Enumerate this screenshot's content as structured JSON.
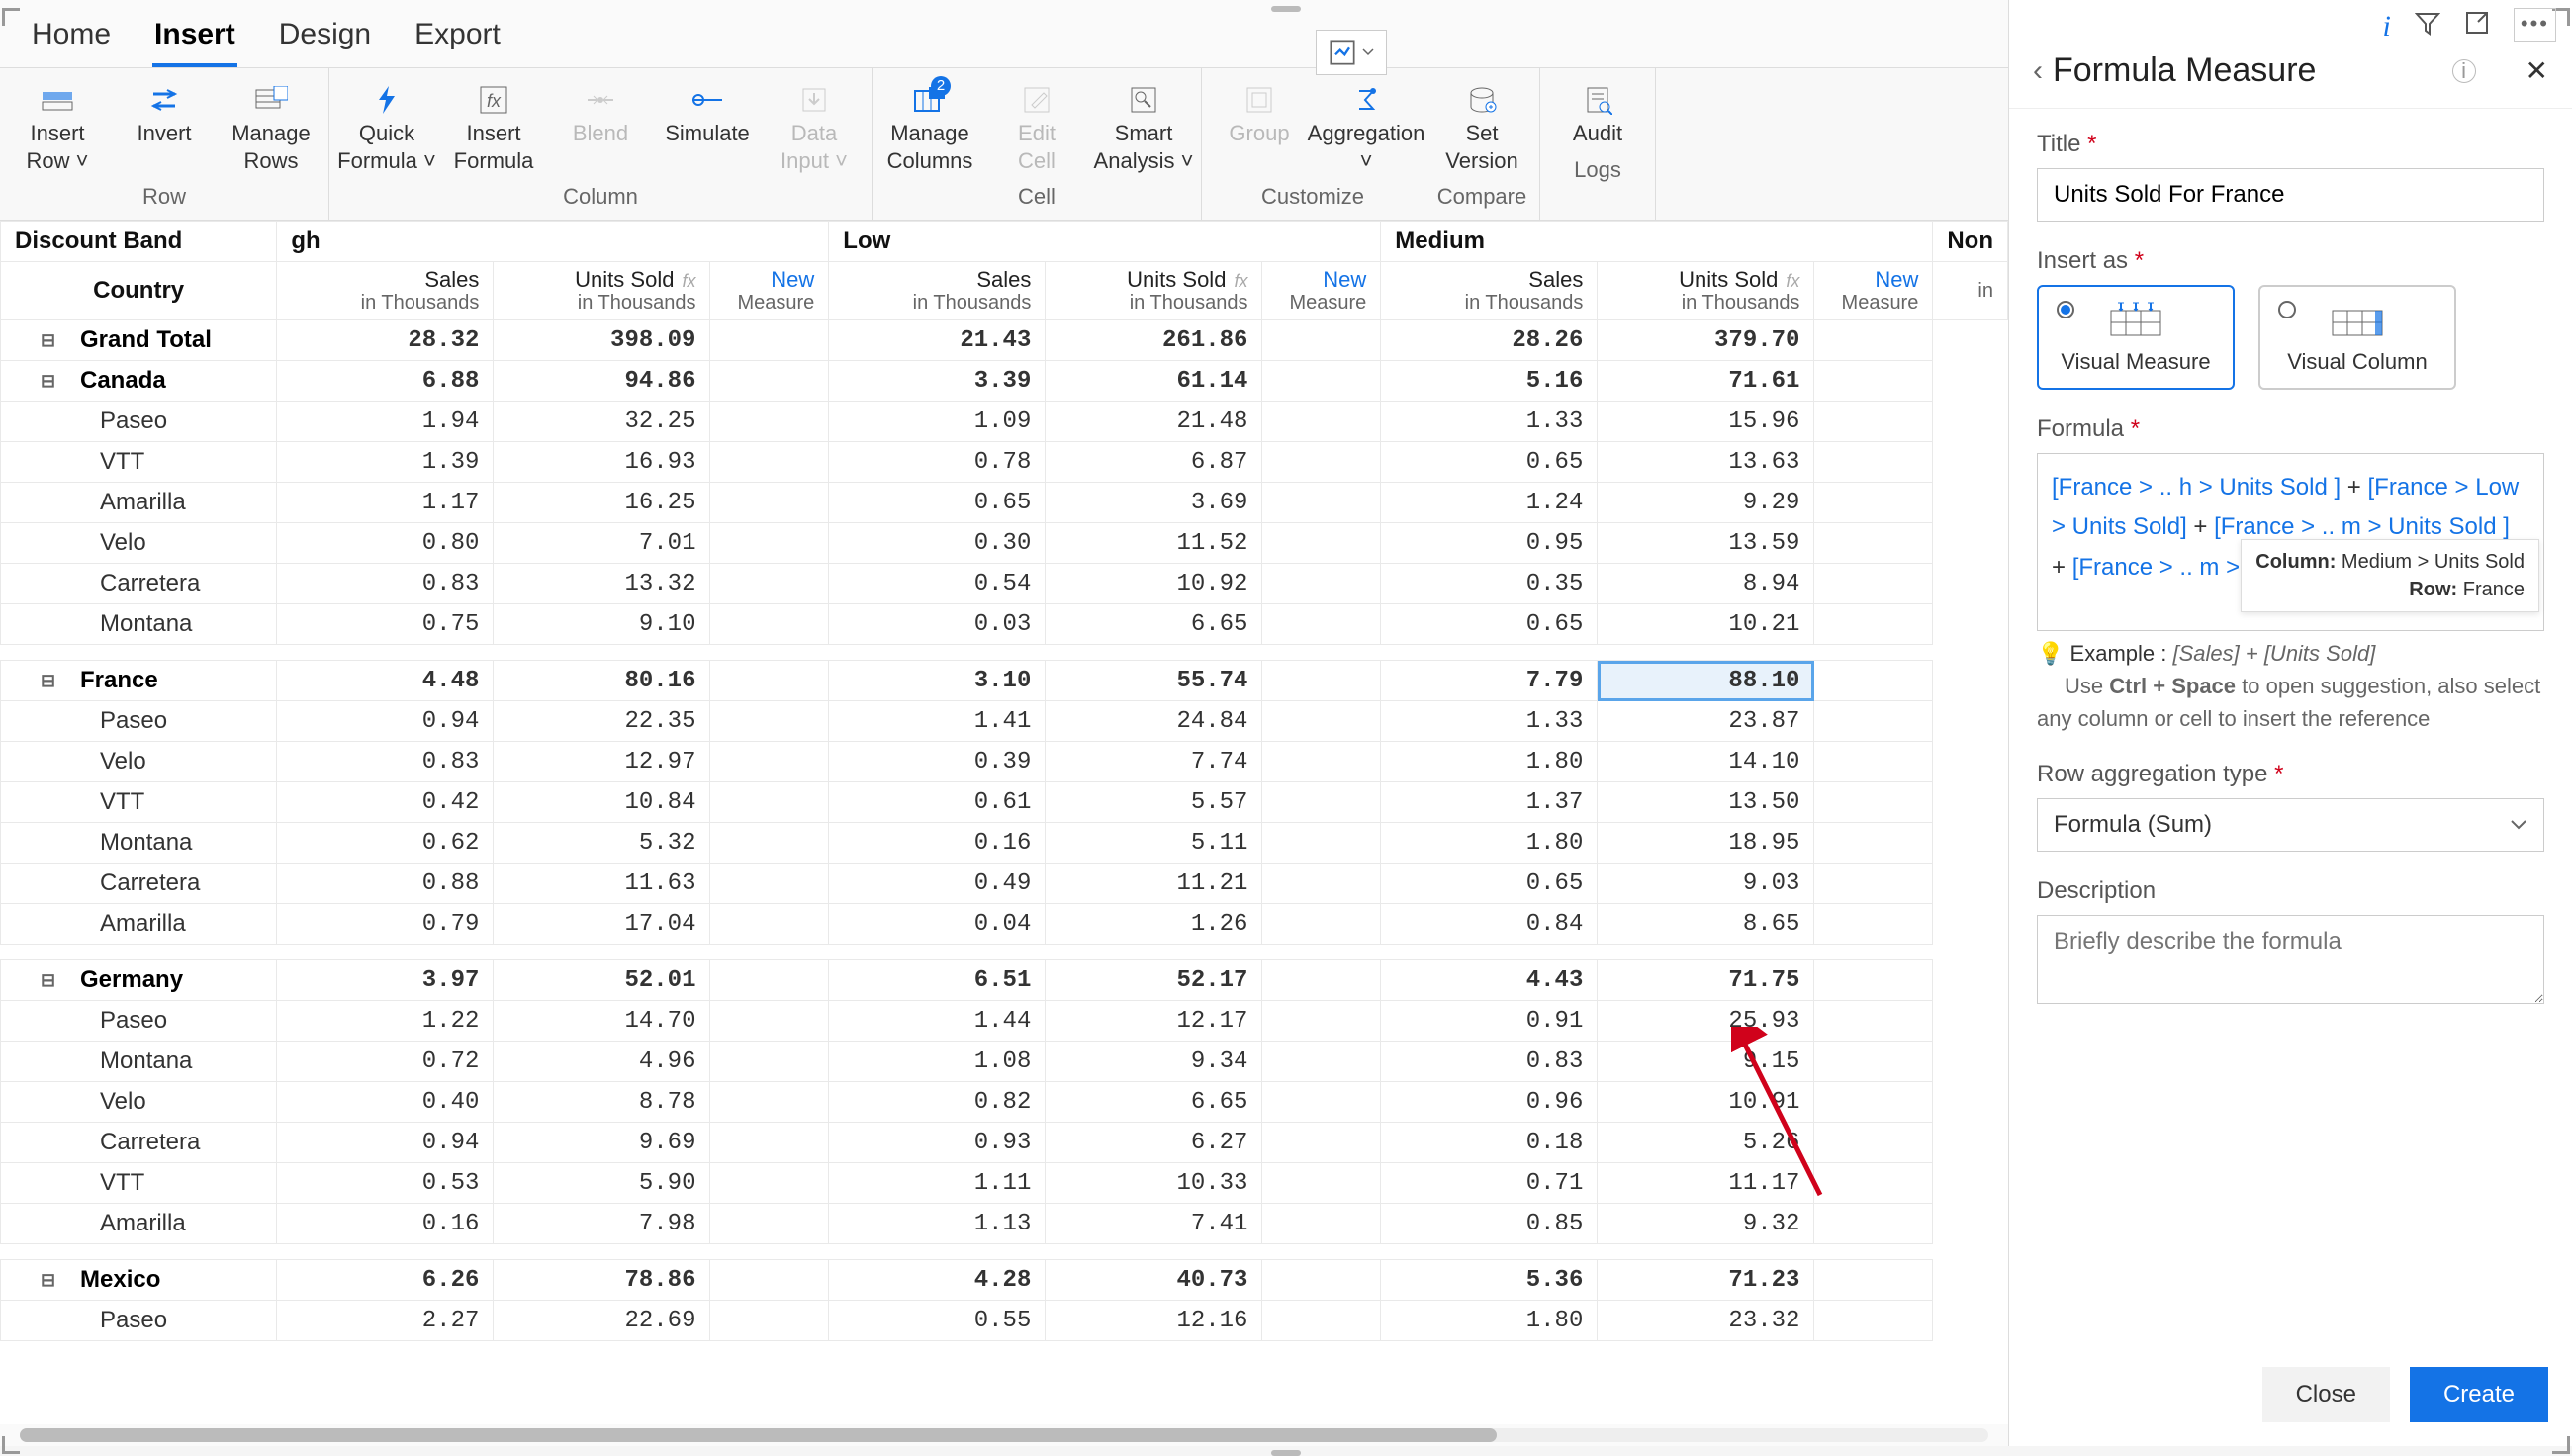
{
  "tabs": [
    "Home",
    "Insert",
    "Design",
    "Export"
  ],
  "active_tab": "Insert",
  "ribbon": [
    {
      "label": "Row",
      "buttons": [
        {
          "l1": "Insert",
          "l2": "Row ˅",
          "icon": "row-insert"
        },
        {
          "l1": "Invert",
          "l2": "",
          "icon": "invert"
        },
        {
          "l1": "Manage",
          "l2": "Rows",
          "icon": "rows"
        }
      ]
    },
    {
      "label": "Column",
      "buttons": [
        {
          "l1": "Quick",
          "l2": "Formula ˅",
          "icon": "bolt"
        },
        {
          "l1": "Insert",
          "l2": "Formula",
          "icon": "formula"
        },
        {
          "l1": "Blend",
          "l2": "",
          "icon": "blend",
          "disabled": true
        },
        {
          "l1": "Simulate",
          "l2": "",
          "icon": "simulate"
        },
        {
          "l1": "Data",
          "l2": "Input ˅",
          "icon": "data",
          "disabled": true
        }
      ]
    },
    {
      "label": "Cell",
      "buttons": [
        {
          "l1": "Manage",
          "l2": "Columns",
          "icon": "cols",
          "badge": "2"
        },
        {
          "l1": "Edit",
          "l2": "Cell",
          "icon": "edit",
          "disabled": true
        },
        {
          "l1": "Smart",
          "l2": "Analysis ˅",
          "icon": "smart"
        }
      ]
    },
    {
      "label": "Customize",
      "buttons": [
        {
          "l1": "Group",
          "l2": "",
          "icon": "group",
          "disabled": true
        },
        {
          "l1": "Aggregation",
          "l2": "˅",
          "icon": "agg"
        }
      ]
    },
    {
      "label": "Compare",
      "buttons": [
        {
          "l1": "Set",
          "l2": "Version",
          "icon": "version"
        }
      ]
    },
    {
      "label": "Logs",
      "buttons": [
        {
          "l1": "Audit",
          "l2": "",
          "icon": "audit"
        }
      ]
    }
  ],
  "table": {
    "corner": "Discount Band",
    "row_label": "Country",
    "bands": [
      "gh",
      "Low",
      "Medium",
      "Non"
    ],
    "measures": [
      {
        "name": "Sales",
        "sub": "in Thousands"
      },
      {
        "name": "Units Sold",
        "sub": "in Thousands",
        "fx": true
      },
      {
        "name": "New",
        "sub": "Measure",
        "new": true
      }
    ],
    "rows": [
      {
        "type": "grand",
        "label": "Grand Total",
        "v": [
          "28.32",
          "398.09",
          "",
          "21.43",
          "261.86",
          "",
          "28.26",
          "379.70",
          ""
        ]
      },
      {
        "type": "country",
        "label": "Canada",
        "v": [
          "6.88",
          "94.86",
          "",
          "3.39",
          "61.14",
          "",
          "5.16",
          "71.61",
          ""
        ]
      },
      {
        "type": "product",
        "label": "Paseo",
        "v": [
          "1.94",
          "32.25",
          "",
          "1.09",
          "21.48",
          "",
          "1.33",
          "15.96",
          ""
        ]
      },
      {
        "type": "product",
        "label": "VTT",
        "v": [
          "1.39",
          "16.93",
          "",
          "0.78",
          "6.87",
          "",
          "0.65",
          "13.63",
          ""
        ]
      },
      {
        "type": "product",
        "label": "Amarilla",
        "v": [
          "1.17",
          "16.25",
          "",
          "0.65",
          "3.69",
          "",
          "1.24",
          "9.29",
          ""
        ]
      },
      {
        "type": "product",
        "label": "Velo",
        "v": [
          "0.80",
          "7.01",
          "",
          "0.30",
          "11.52",
          "",
          "0.95",
          "13.59",
          ""
        ]
      },
      {
        "type": "product",
        "label": "Carretera",
        "v": [
          "0.83",
          "13.32",
          "",
          "0.54",
          "10.92",
          "",
          "0.35",
          "8.94",
          ""
        ]
      },
      {
        "type": "product",
        "label": "Montana",
        "v": [
          "0.75",
          "9.10",
          "",
          "0.03",
          "6.65",
          "",
          "0.65",
          "10.21",
          ""
        ]
      },
      {
        "type": "country",
        "label": "France",
        "v": [
          "4.48",
          "80.16",
          "",
          "3.10",
          "55.74",
          "",
          "7.79",
          "88.10",
          ""
        ],
        "sel": 7
      },
      {
        "type": "product",
        "label": "Paseo",
        "v": [
          "0.94",
          "22.35",
          "",
          "1.41",
          "24.84",
          "",
          "1.33",
          "23.87",
          ""
        ]
      },
      {
        "type": "product",
        "label": "Velo",
        "v": [
          "0.83",
          "12.97",
          "",
          "0.39",
          "7.74",
          "",
          "1.80",
          "14.10",
          ""
        ]
      },
      {
        "type": "product",
        "label": "VTT",
        "v": [
          "0.42",
          "10.84",
          "",
          "0.61",
          "5.57",
          "",
          "1.37",
          "13.50",
          ""
        ]
      },
      {
        "type": "product",
        "label": "Montana",
        "v": [
          "0.62",
          "5.32",
          "",
          "0.16",
          "5.11",
          "",
          "1.80",
          "18.95",
          ""
        ]
      },
      {
        "type": "product",
        "label": "Carretera",
        "v": [
          "0.88",
          "11.63",
          "",
          "0.49",
          "11.21",
          "",
          "0.65",
          "9.03",
          ""
        ]
      },
      {
        "type": "product",
        "label": "Amarilla",
        "v": [
          "0.79",
          "17.04",
          "",
          "0.04",
          "1.26",
          "",
          "0.84",
          "8.65",
          ""
        ]
      },
      {
        "type": "country",
        "label": "Germany",
        "v": [
          "3.97",
          "52.01",
          "",
          "6.51",
          "52.17",
          "",
          "4.43",
          "71.75",
          ""
        ]
      },
      {
        "type": "product",
        "label": "Paseo",
        "v": [
          "1.22",
          "14.70",
          "",
          "1.44",
          "12.17",
          "",
          "0.91",
          "25.93",
          ""
        ]
      },
      {
        "type": "product",
        "label": "Montana",
        "v": [
          "0.72",
          "4.96",
          "",
          "1.08",
          "9.34",
          "",
          "0.83",
          "9.15",
          ""
        ]
      },
      {
        "type": "product",
        "label": "Velo",
        "v": [
          "0.40",
          "8.78",
          "",
          "0.82",
          "6.65",
          "",
          "0.96",
          "10.91",
          ""
        ]
      },
      {
        "type": "product",
        "label": "Carretera",
        "v": [
          "0.94",
          "9.69",
          "",
          "0.93",
          "6.27",
          "",
          "0.18",
          "5.26",
          ""
        ]
      },
      {
        "type": "product",
        "label": "VTT",
        "v": [
          "0.53",
          "5.90",
          "",
          "1.11",
          "10.33",
          "",
          "0.71",
          "11.17",
          ""
        ]
      },
      {
        "type": "product",
        "label": "Amarilla",
        "v": [
          "0.16",
          "7.98",
          "",
          "1.13",
          "7.41",
          "",
          "0.85",
          "9.32",
          ""
        ]
      },
      {
        "type": "country",
        "label": "Mexico",
        "v": [
          "6.26",
          "78.86",
          "",
          "4.28",
          "40.73",
          "",
          "5.36",
          "71.23",
          ""
        ]
      },
      {
        "type": "product",
        "label": "Paseo",
        "v": [
          "2.27",
          "22.69",
          "",
          "0.55",
          "12.16",
          "",
          "1.80",
          "23.32",
          ""
        ]
      }
    ]
  },
  "panel": {
    "title": "Formula Measure",
    "title_field": {
      "label": "Title",
      "value": "Units Sold For France"
    },
    "insert_as": {
      "label": "Insert as",
      "options": [
        "Visual Measure",
        "Visual Column"
      ],
      "selected": 0
    },
    "formula": {
      "label": "Formula",
      "tokens": [
        "[France > .. h > Units Sold ]",
        "+",
        "[France > Low > Units Sold]",
        "+",
        "[France > .. m > Units Sold ]",
        "+",
        "[France > .. m > Units Sold ]"
      ],
      "tooltip": {
        "l1_k": "Column:",
        "l1_v": "Medium > Units Sold",
        "l2_k": "Row:",
        "l2_v": "France"
      }
    },
    "example": {
      "prefix": "Example :",
      "text": "[Sales] + [Units Sold]",
      "hint1": "Use ",
      "hint_key": "Ctrl + Space",
      "hint2": " to open suggestion, also select any column or cell to insert the reference"
    },
    "row_agg": {
      "label": "Row aggregation type",
      "value": "Formula (Sum)"
    },
    "description": {
      "label": "Description",
      "placeholder": "Briefly describe the formula"
    },
    "buttons": {
      "close": "Close",
      "create": "Create"
    }
  }
}
